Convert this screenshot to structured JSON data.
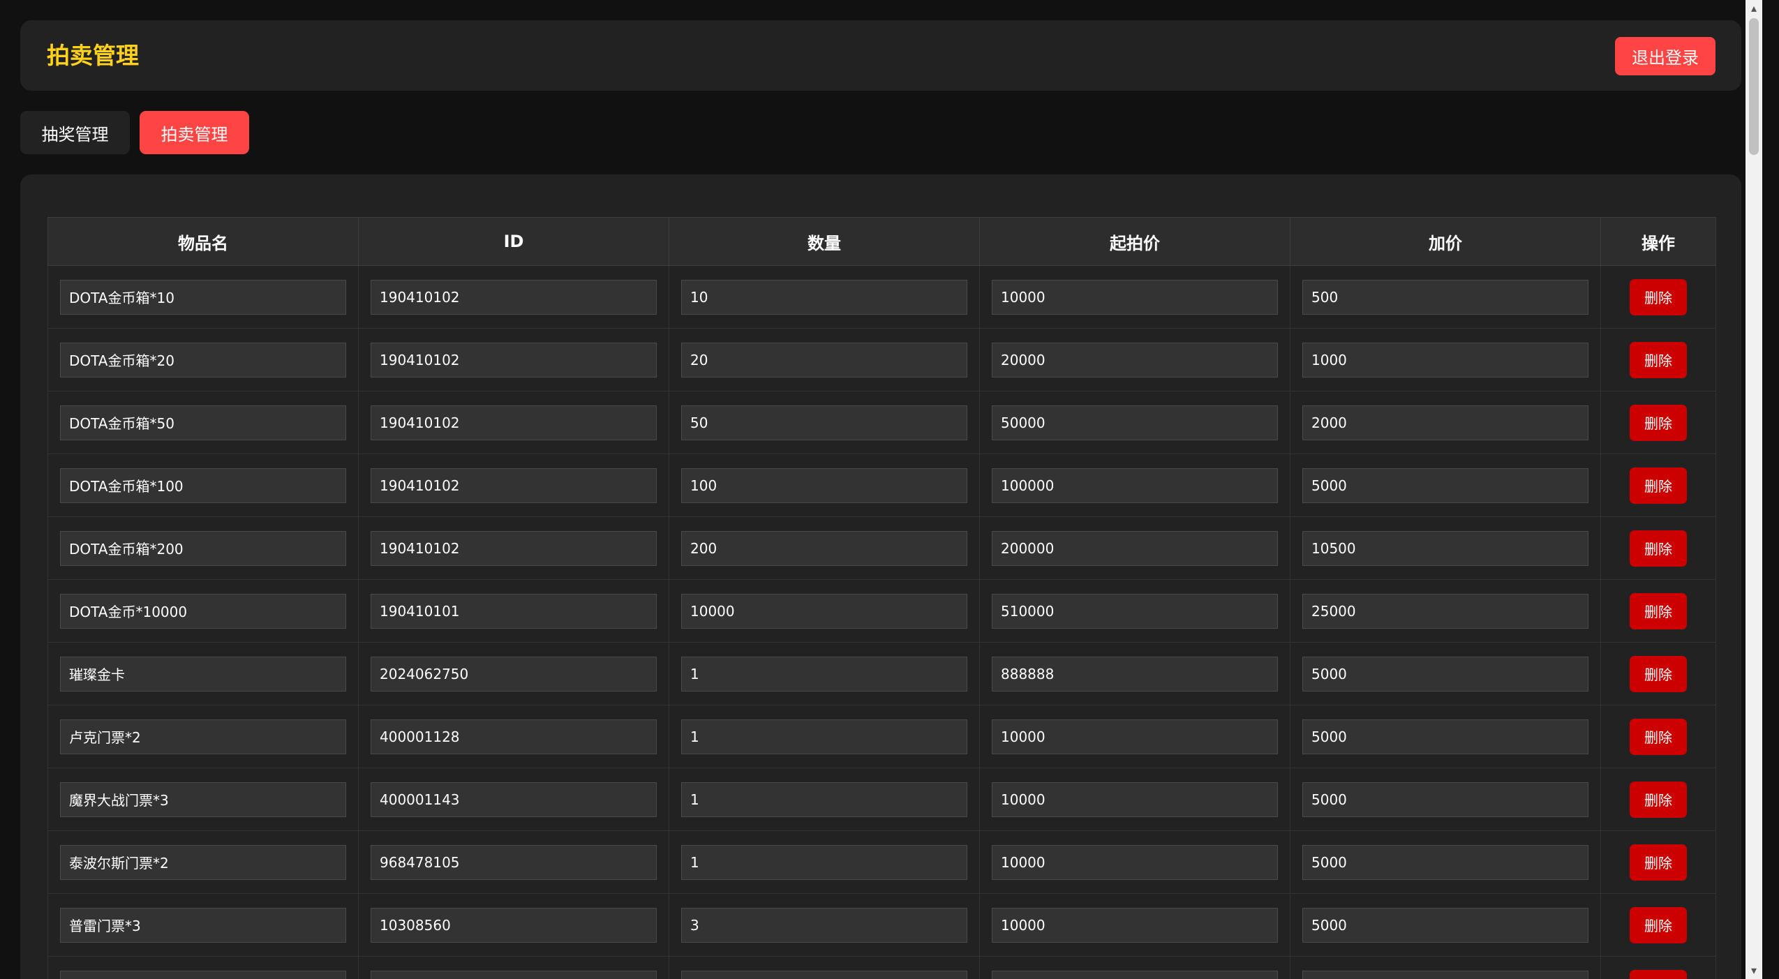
{
  "header": {
    "title": "拍卖管理",
    "logout_label": "退出登录"
  },
  "tabs": [
    {
      "label": "抽奖管理",
      "active": false
    },
    {
      "label": "拍卖管理",
      "active": true
    }
  ],
  "table": {
    "columns": [
      "物品名",
      "ID",
      "数量",
      "起拍价",
      "加价",
      "操作"
    ],
    "delete_label": "删除",
    "rows": [
      {
        "name": "DOTA金币箱*10",
        "id": "190410102",
        "quantity": "10",
        "start_price": "10000",
        "increment": "500"
      },
      {
        "name": "DOTA金币箱*20",
        "id": "190410102",
        "quantity": "20",
        "start_price": "20000",
        "increment": "1000"
      },
      {
        "name": "DOTA金币箱*50",
        "id": "190410102",
        "quantity": "50",
        "start_price": "50000",
        "increment": "2000"
      },
      {
        "name": "DOTA金币箱*100",
        "id": "190410102",
        "quantity": "100",
        "start_price": "100000",
        "increment": "5000"
      },
      {
        "name": "DOTA金币箱*200",
        "id": "190410102",
        "quantity": "200",
        "start_price": "200000",
        "increment": "10500"
      },
      {
        "name": "DOTA金币*10000",
        "id": "190410101",
        "quantity": "10000",
        "start_price": "510000",
        "increment": "25000"
      },
      {
        "name": "璀璨金卡",
        "id": "2024062750",
        "quantity": "1",
        "start_price": "888888",
        "increment": "5000"
      },
      {
        "name": "卢克门票*2",
        "id": "400001128",
        "quantity": "1",
        "start_price": "10000",
        "increment": "5000"
      },
      {
        "name": "魔界大战门票*3",
        "id": "400001143",
        "quantity": "1",
        "start_price": "10000",
        "increment": "5000"
      },
      {
        "name": "泰波尔斯门票*2",
        "id": "968478105",
        "quantity": "1",
        "start_price": "10000",
        "increment": "5000"
      },
      {
        "name": "普雷门票*3",
        "id": "10308560",
        "quantity": "3",
        "start_price": "10000",
        "increment": "5000"
      },
      {
        "name": "",
        "id": "",
        "quantity": "",
        "start_price": "",
        "increment": ""
      }
    ]
  },
  "colors": {
    "background": "#111111",
    "panel": "#222222",
    "title_accent": "#ffd11a",
    "primary_button": "#ff4444",
    "delete_button": "#cc0000"
  }
}
